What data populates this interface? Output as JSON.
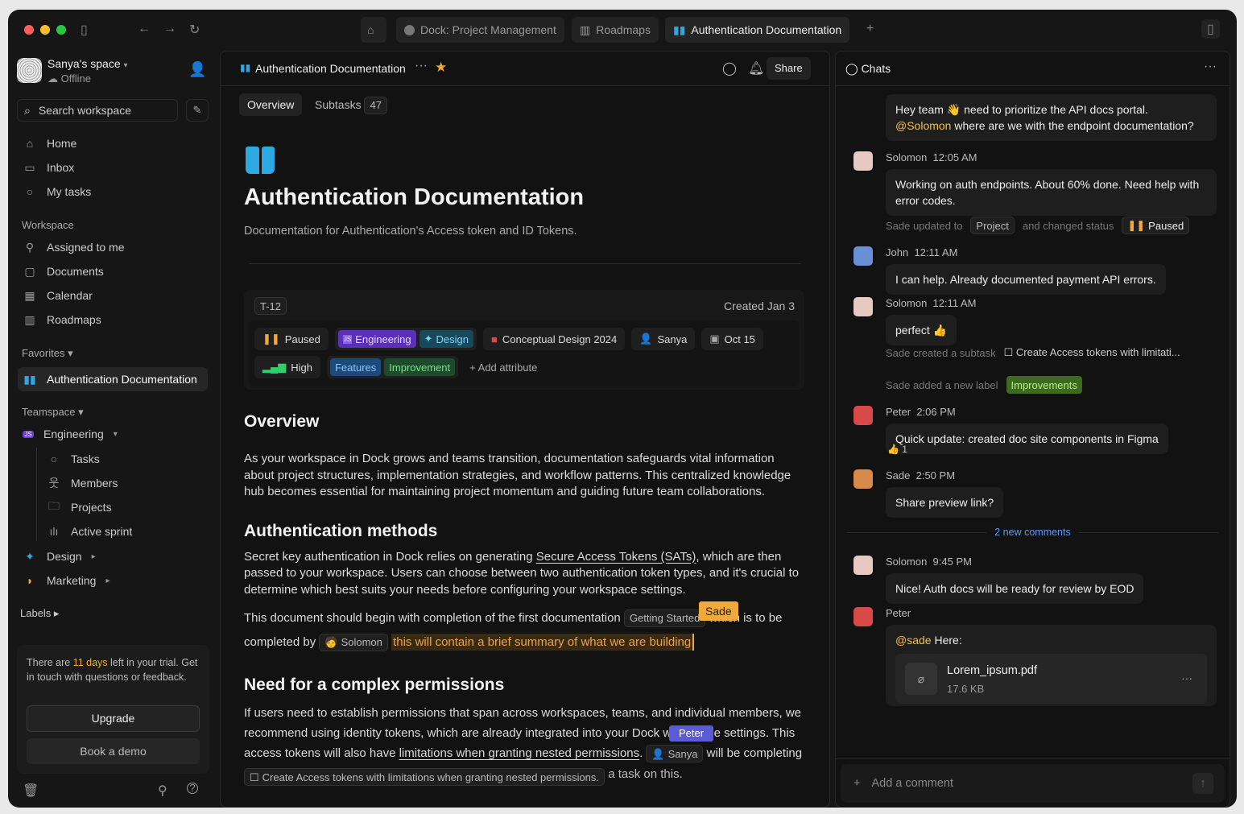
{
  "colors": {
    "accent": "#f2a93b",
    "link": "#4da3ff",
    "paused": "#f2a93b",
    "peter": "#5b5bd6",
    "sade": "#f2a93b"
  },
  "tabs": [
    {
      "label": "Dock: Project Management",
      "icon": "dock-logo-icon"
    },
    {
      "label": "Roadmaps",
      "icon": "map-icon"
    },
    {
      "label": "Authentication Documentation",
      "icon": "book-icon"
    }
  ],
  "sidebar": {
    "space": "Sanya's space",
    "status": "Offline",
    "search": "Search workspace",
    "nav": [
      "Home",
      "Inbox",
      "My tasks"
    ],
    "workspace_label": "Workspace",
    "workspace": [
      "Assigned to me",
      "Documents",
      "Calendar",
      "Roadmaps"
    ],
    "favorites_label": "Favorites",
    "favorite": "Authentication Documentation",
    "teamspace_label": "Teamspace",
    "team": "Engineering",
    "team_items": [
      "Tasks",
      "Members",
      "Projects",
      "Active sprint"
    ],
    "design": "Design",
    "marketing": "Marketing",
    "labels": "Labels",
    "trial": {
      "pre": "There are ",
      "days": "11 days",
      "post": " left in your trial. Get in touch with questions or feedback."
    },
    "upgrade": "Upgrade",
    "demo": "Book a demo"
  },
  "doc": {
    "title": "Authentication Documentation",
    "share": "Share",
    "tabs": {
      "overview": "Overview",
      "subtasks": "Subtasks",
      "subtasks_count": "47"
    },
    "heading": "Authentication Documentation",
    "subtitle": "Documentation for Authentication's Access token and ID Tokens.",
    "meta": {
      "id": "T-12",
      "created": "Created Jan 3",
      "status": "Paused",
      "teams": [
        "Engineering",
        "Design"
      ],
      "project": "Conceptual Design 2024",
      "assignee": "Sanya",
      "due": "Oct 15",
      "priority": "High",
      "labels": [
        "Features",
        "Improvement"
      ],
      "add": "Add attribute"
    },
    "overview_h": "Overview",
    "overview_p": "As your workspace in Dock grows and teams transition, documentation safeguards vital information about project structures, implementation strategies, and workflow patterns. This centralized knowledge hub becomes essential for maintaining project momentum and guiding future team collaborations.",
    "auth_h": "Authentication methods",
    "auth_p1a": "Secret key authentication in Dock relies on generating ",
    "auth_link": "Secure Access Tokens (SATs)",
    "auth_p1b": ", which are then passed to your workspace. Users can choose between two authentication token types, and it's crucial to determine which best suits your needs before configuring your workspace settings.",
    "auth_p2a": "This document should begin with completion of the first documentation ",
    "chip_doc": "Getting Started",
    "auth_p2b": "which is to be completed by ",
    "chip_user": "Solomon",
    "highlight": "this will contain a brief summary of what we are building",
    "sade": "Sade",
    "peter": "Peter",
    "perm_h": "Need for a complex permissions",
    "perm_p1": "If users need to establish permissions that span across workspaces, teams, and individual members, we recommend using identity tokens, which are already integrated into your Dock workspace settings. This access tokens will also have ",
    "perm_link": "limitations when granting nested permissions",
    "perm_user": "Sanya",
    "perm_p2": " will be completing",
    "perm_task": "Create Access tokens with limitations when granting nested permissions.",
    "perm_p3": "a task on this."
  },
  "chat": {
    "title": "Chats",
    "new_comments": "2 new comments",
    "add_comment": "Add a comment",
    "m0a": "Hey team 👋 need to prioritize the API docs portal. ",
    "m0mention": "@Solomon",
    "m0b": " where are we with the endpoint documentation?",
    "messages": [
      {
        "name": "Solomon",
        "time": "12:05 AM",
        "text": "Working on auth endpoints. About 60% done. Need help with error codes."
      },
      {
        "name": "John",
        "time": "12:11 AM",
        "text": "I can help. Already documented payment API errors."
      },
      {
        "name": "Solomon",
        "time": "12:11 AM",
        "text": "perfect 👍"
      },
      {
        "name": "Peter",
        "time": "2:06 PM",
        "text": "Quick update: created doc site components in Figma",
        "reaction": "👍 1"
      },
      {
        "name": "Sade",
        "time": "2:50 PM",
        "text": "Share preview link?"
      },
      {
        "name": "Solomon",
        "time": "9:45 PM",
        "text": "Nice! Auth docs will be ready for review by EOD"
      },
      {
        "name": "Peter",
        "time": ""
      }
    ],
    "act1": {
      "a": "Sade updated to",
      "b": "Project",
      "c": "and changed status",
      "d": "Paused"
    },
    "act2": {
      "a": "Sade created a subtask",
      "b": "Create Access tokens with limitati..."
    },
    "act3": {
      "a": "Sade added a new label",
      "b": "Improvements"
    },
    "last": {
      "mention": "@sade",
      "text": " Here:",
      "file": "Lorem_ipsum.pdf",
      "size": "17.6 KB"
    }
  }
}
